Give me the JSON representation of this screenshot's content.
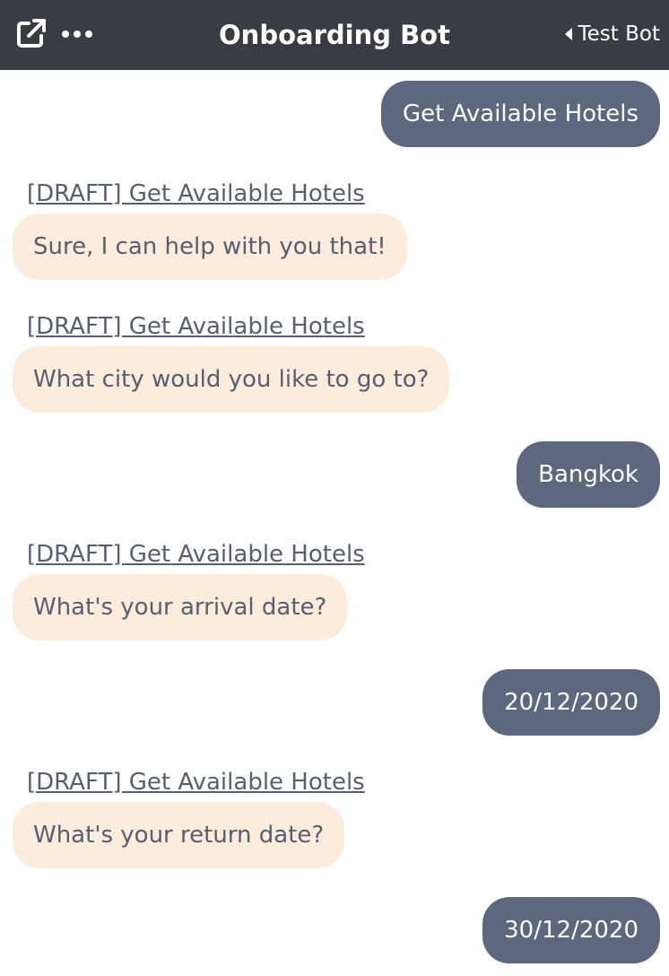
{
  "header": {
    "title": "Onboarding Bot",
    "back_label": "Test Bot",
    "icons": [
      "external-link-icon",
      "more-icon",
      "back-caret-icon"
    ]
  },
  "colors": {
    "header_bg": "#393c43",
    "user_bubble": "#5d677d",
    "bot_bubble": "#fcecdc",
    "bot_text": "#565e72"
  },
  "messages": [
    {
      "sender": "user",
      "text": "Get Available Hotels"
    },
    {
      "sender": "bot",
      "source": "[DRAFT] Get Available Hotels",
      "text": "Sure, I can help with you that!"
    },
    {
      "sender": "bot",
      "source": "[DRAFT] Get Available Hotels",
      "text": "What city would you like to go to?"
    },
    {
      "sender": "user",
      "text": "Bangkok"
    },
    {
      "sender": "bot",
      "source": "[DRAFT] Get Available Hotels",
      "text": "What's your arrival date?"
    },
    {
      "sender": "user",
      "text": "20/12/2020"
    },
    {
      "sender": "bot",
      "source": "[DRAFT] Get Available Hotels",
      "text": "What's your return date?"
    },
    {
      "sender": "user",
      "text": "30/12/2020"
    }
  ]
}
